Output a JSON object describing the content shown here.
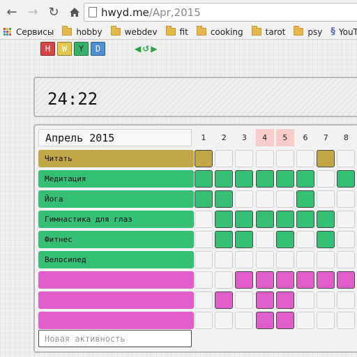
{
  "browser": {
    "url_host": "hwyd.me",
    "url_path": "/Apr,2015",
    "bookmarks": [
      {
        "label": "Сервисы",
        "icon": "apps-icon"
      },
      {
        "label": "hobby",
        "icon": "folder-icon"
      },
      {
        "label": "webdev",
        "icon": "folder-icon"
      },
      {
        "label": "fit",
        "icon": "folder-icon"
      },
      {
        "label": "cooking",
        "icon": "folder-icon"
      },
      {
        "label": "tarot",
        "icon": "folder-icon"
      },
      {
        "label": "psy",
        "icon": "folder-icon"
      },
      {
        "label": "YouTu",
        "icon": "youtube-icon"
      }
    ]
  },
  "logo": {
    "letters": [
      {
        "char": "H",
        "color": "#d84545"
      },
      {
        "char": "W",
        "color": "#e0c84a"
      },
      {
        "char": "Y",
        "color": "#36b36a"
      },
      {
        "char": "D",
        "color": "#4f8fd6"
      }
    ]
  },
  "clock": {
    "time": "24:22"
  },
  "calendar": {
    "month": "Апрель 2015",
    "days": [
      {
        "num": "1",
        "weekend": false
      },
      {
        "num": "2",
        "weekend": false
      },
      {
        "num": "3",
        "weekend": false
      },
      {
        "num": "4",
        "weekend": true
      },
      {
        "num": "5",
        "weekend": true
      },
      {
        "num": "6",
        "weekend": false
      },
      {
        "num": "7",
        "weekend": false
      },
      {
        "num": "8",
        "weekend": false
      }
    ],
    "activities": [
      {
        "name": "Читать",
        "color": "#c2a745",
        "marks": [
          1,
          0,
          0,
          0,
          0,
          0,
          1,
          0
        ]
      },
      {
        "name": "Медитация",
        "color": "#35bf74",
        "marks": [
          1,
          1,
          1,
          1,
          1,
          1,
          0,
          1
        ]
      },
      {
        "name": "Йога",
        "color": "#35bf74",
        "marks": [
          1,
          1,
          0,
          0,
          0,
          1,
          0,
          0
        ]
      },
      {
        "name": "Гимнастика для глаз",
        "color": "#35bf74",
        "marks": [
          0,
          1,
          1,
          1,
          1,
          1,
          1,
          0
        ]
      },
      {
        "name": "Фитнес",
        "color": "#35bf74",
        "marks": [
          0,
          1,
          1,
          0,
          1,
          0,
          1,
          0
        ]
      },
      {
        "name": "Велосипед",
        "color": "#35bf74",
        "marks": [
          0,
          0,
          0,
          0,
          0,
          0,
          0,
          0
        ]
      },
      {
        "name": "",
        "color": "#e05dca",
        "marks": [
          0,
          0,
          1,
          1,
          1,
          1,
          1,
          1
        ]
      },
      {
        "name": "",
        "color": "#e05dca",
        "marks": [
          0,
          1,
          0,
          1,
          1,
          0,
          0,
          0
        ]
      },
      {
        "name": "",
        "color": "#e05dca",
        "marks": [
          0,
          0,
          0,
          1,
          1,
          0,
          0,
          0
        ]
      }
    ],
    "new_activity_placeholder": "Новая активность"
  }
}
